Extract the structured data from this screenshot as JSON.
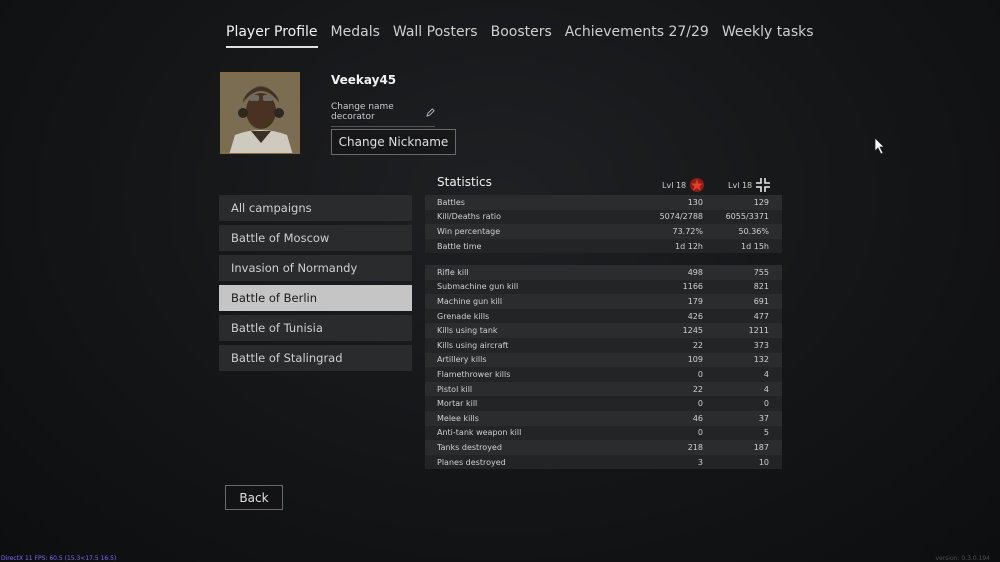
{
  "tabs": [
    {
      "label": "Player Profile",
      "active": true
    },
    {
      "label": "Medals"
    },
    {
      "label": "Wall Posters"
    },
    {
      "label": "Boosters"
    },
    {
      "label": "Achievements 27/29"
    },
    {
      "label": "Weekly tasks"
    }
  ],
  "profile": {
    "nickname": "Veekay45",
    "decorator_label": "Change name decorator",
    "change_nickname_label": "Change Nickname"
  },
  "campaigns": [
    {
      "label": "All campaigns"
    },
    {
      "label": "Battle of Moscow"
    },
    {
      "label": "Invasion of Normandy"
    },
    {
      "label": "Battle of Berlin",
      "selected": true
    },
    {
      "label": "Battle of Tunisia"
    },
    {
      "label": "Battle of Stalingrad"
    }
  ],
  "statistics": {
    "title": "Statistics",
    "level_1": "Lvl 18",
    "level_2": "Lvl 18",
    "summary": [
      {
        "label": "Battles",
        "v1": "130",
        "v2": "129"
      },
      {
        "label": "Kill/Deaths ratio",
        "v1": "5074/2788",
        "v2": "6055/3371"
      },
      {
        "label": "Win percentage",
        "v1": "73.72%",
        "v2": "50.36%"
      },
      {
        "label": "Battle time",
        "v1": "1d 12h",
        "v2": "1d 15h"
      }
    ],
    "kills": [
      {
        "label": "Rifle kill",
        "v1": "498",
        "v2": "755"
      },
      {
        "label": "Submachine gun kill",
        "v1": "1166",
        "v2": "821"
      },
      {
        "label": "Machine gun kill",
        "v1": "179",
        "v2": "691"
      },
      {
        "label": "Grenade kills",
        "v1": "426",
        "v2": "477"
      },
      {
        "label": "Kills using tank",
        "v1": "1245",
        "v2": "1211"
      },
      {
        "label": "Kills using aircraft",
        "v1": "22",
        "v2": "373"
      },
      {
        "label": "Artillery kills",
        "v1": "109",
        "v2": "132"
      },
      {
        "label": "Flamethrower kills",
        "v1": "0",
        "v2": "4"
      },
      {
        "label": "Pistol kill",
        "v1": "22",
        "v2": "4"
      },
      {
        "label": "Mortar kill",
        "v1": "0",
        "v2": "0"
      },
      {
        "label": "Melee kills",
        "v1": "46",
        "v2": "37"
      },
      {
        "label": "Anti-tank weapon kill",
        "v1": "0",
        "v2": "5"
      },
      {
        "label": "Tanks destroyed",
        "v1": "218",
        "v2": "187"
      },
      {
        "label": "Planes destroyed",
        "v1": "3",
        "v2": "10"
      }
    ]
  },
  "back_label": "Back",
  "fps_text": "DirectX 11 FPS: 60.5 (15.3<17.5 16.5)",
  "version_text": "version: 0.3.0.194",
  "colors": {
    "accent_red": "#c0392b",
    "selected_bg": "#c5c5c5",
    "row_bg": "#2b2c2e"
  }
}
